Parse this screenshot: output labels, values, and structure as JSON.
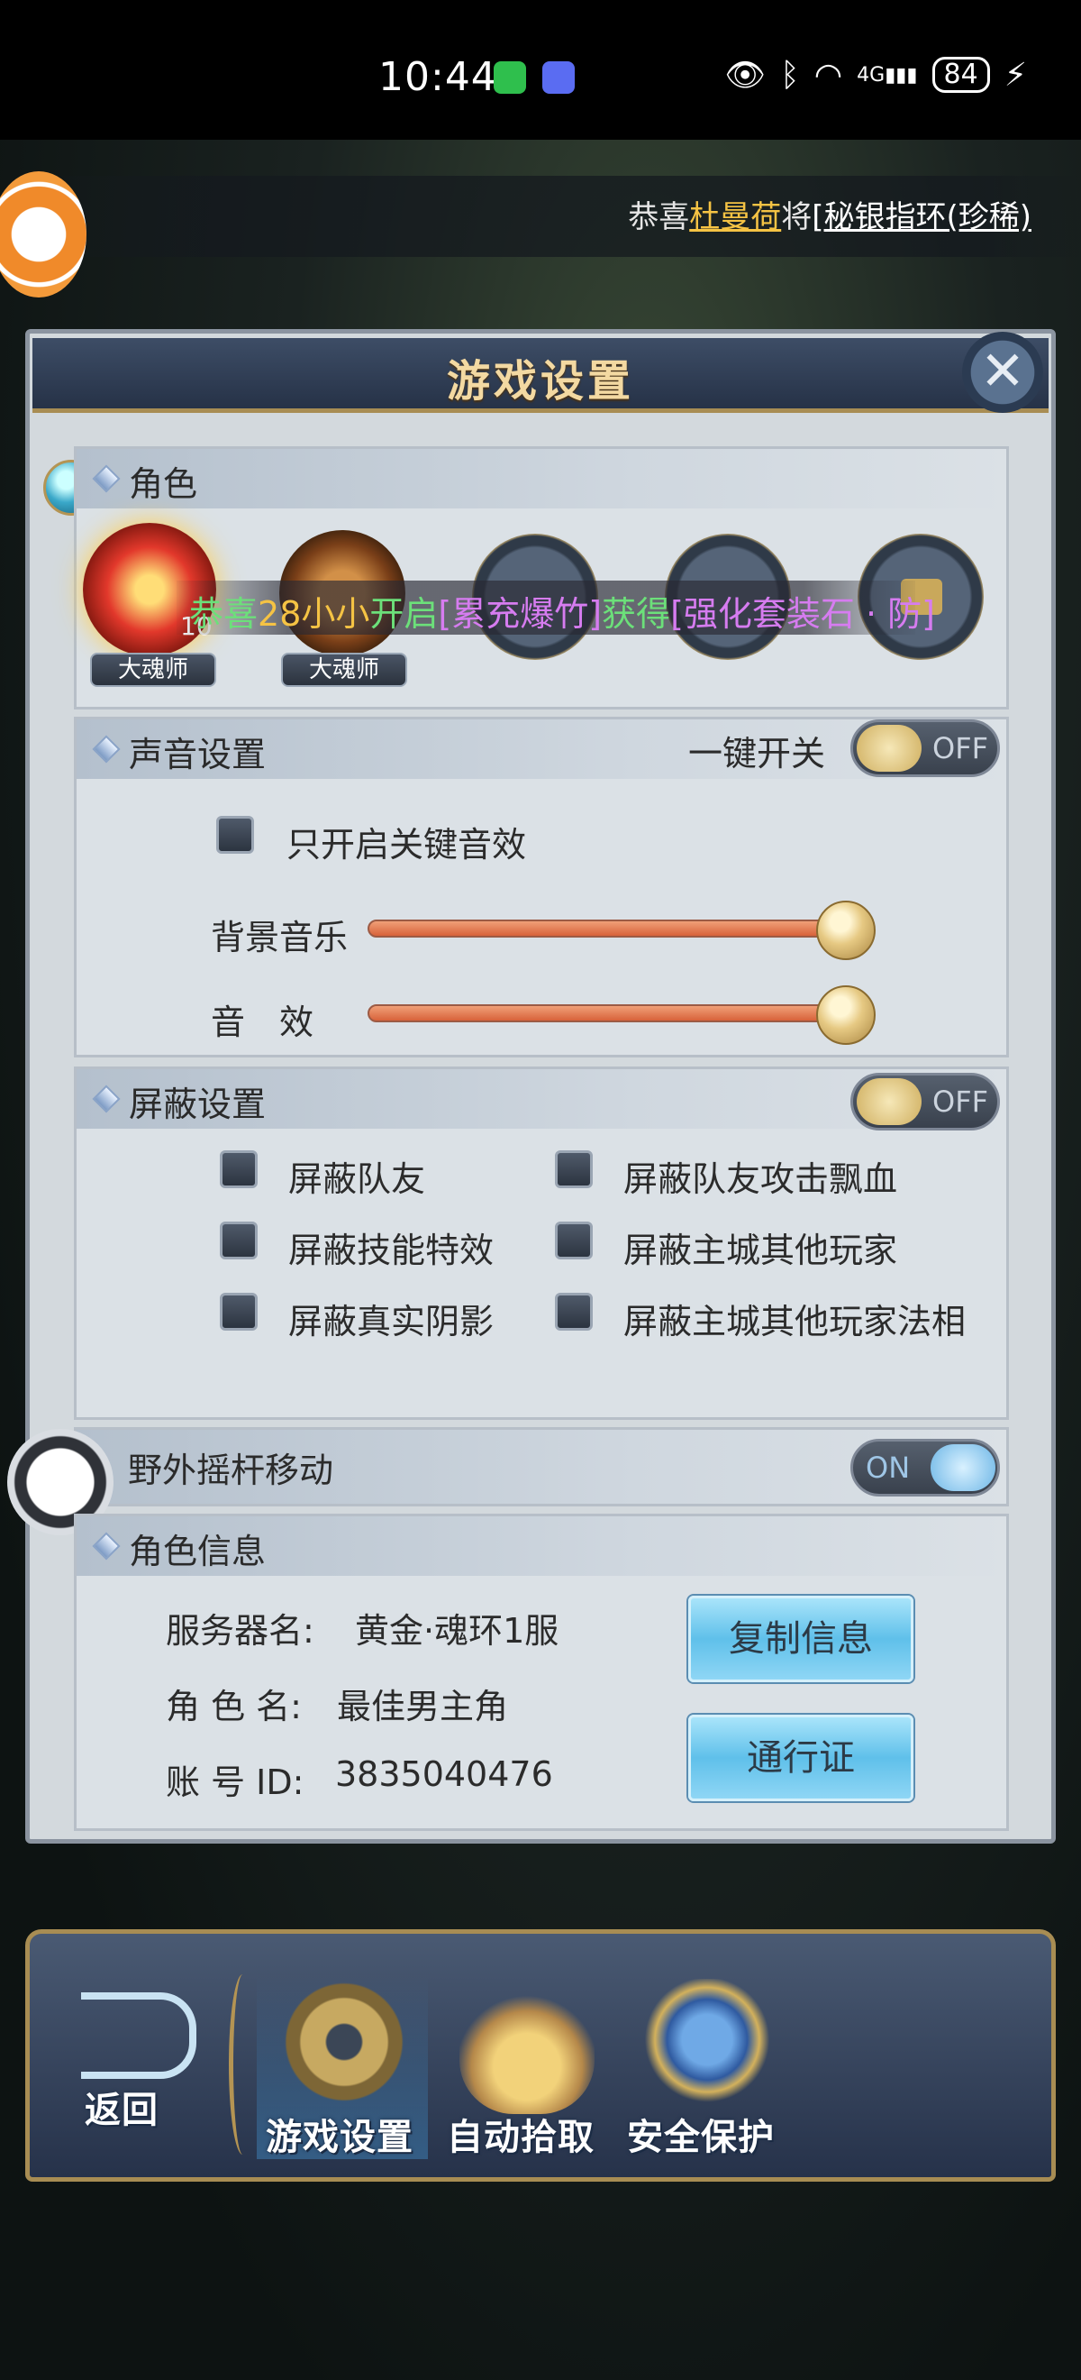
{
  "status_bar": {
    "time": "10:44",
    "apps": [
      "wechat-icon",
      "music-icon"
    ],
    "icons": [
      "eye-icon",
      "bluetooth-icon",
      "wifi-icon",
      "4g-signal-icon",
      "charging-icon"
    ],
    "network": "4G",
    "battery": "84"
  },
  "marquee": {
    "prefix": "恭喜",
    "player": "杜曼荷",
    "mid": "将",
    "item": "[秘银指环(珍稀)"
  },
  "dialog": {
    "title": "游戏设置",
    "role_section": {
      "title": "角色",
      "roles": [
        {
          "level": "10",
          "tag": "大魂师"
        },
        {
          "level": "",
          "tag": "大魂师"
        }
      ],
      "broadcast": {
        "p1": "恭喜",
        "p2": "28小小",
        "p3": "开启",
        "p4": "[累充爆竹]",
        "p5": "获得",
        "p6": "[强化套装石 · 防]"
      }
    },
    "sound": {
      "title": "声音设置",
      "master_label": "一键开关",
      "master_state": "OFF",
      "key_only_label": "只开启关键音效",
      "bgm_label": "背景音乐",
      "sfx_label": "音　效",
      "bgm_level": 1.0,
      "sfx_level": 1.0
    },
    "block": {
      "title": "屏蔽设置",
      "state": "OFF",
      "options": [
        "屏蔽队友",
        "屏蔽队友攻击飘血",
        "屏蔽技能特效",
        "屏蔽主城其他玩家",
        "屏蔽真实阴影",
        "屏蔽主城其他玩家法相"
      ]
    },
    "joystick": {
      "label": "野外摇杆移动",
      "state": "ON"
    },
    "info": {
      "title": "角色信息",
      "server_label": "服务器名:",
      "server_value": "黄金·魂环1服",
      "role_label": "角 色 名:",
      "role_value": "最佳男主角",
      "id_label": "账 号 ID:",
      "id_value": "3835040476",
      "copy_button": "复制信息",
      "pass_button": "通行证"
    }
  },
  "bottom_nav": {
    "back": "返回",
    "tabs": [
      "游戏设置",
      "自动拾取",
      "安全保护"
    ]
  },
  "colors": {
    "accent_gold": "#f5c344",
    "button_blue": "#5fc0ea",
    "slider_orange": "#d8623a",
    "broadcast_green": "#6ce07a",
    "broadcast_purple": "#d67cf0"
  }
}
